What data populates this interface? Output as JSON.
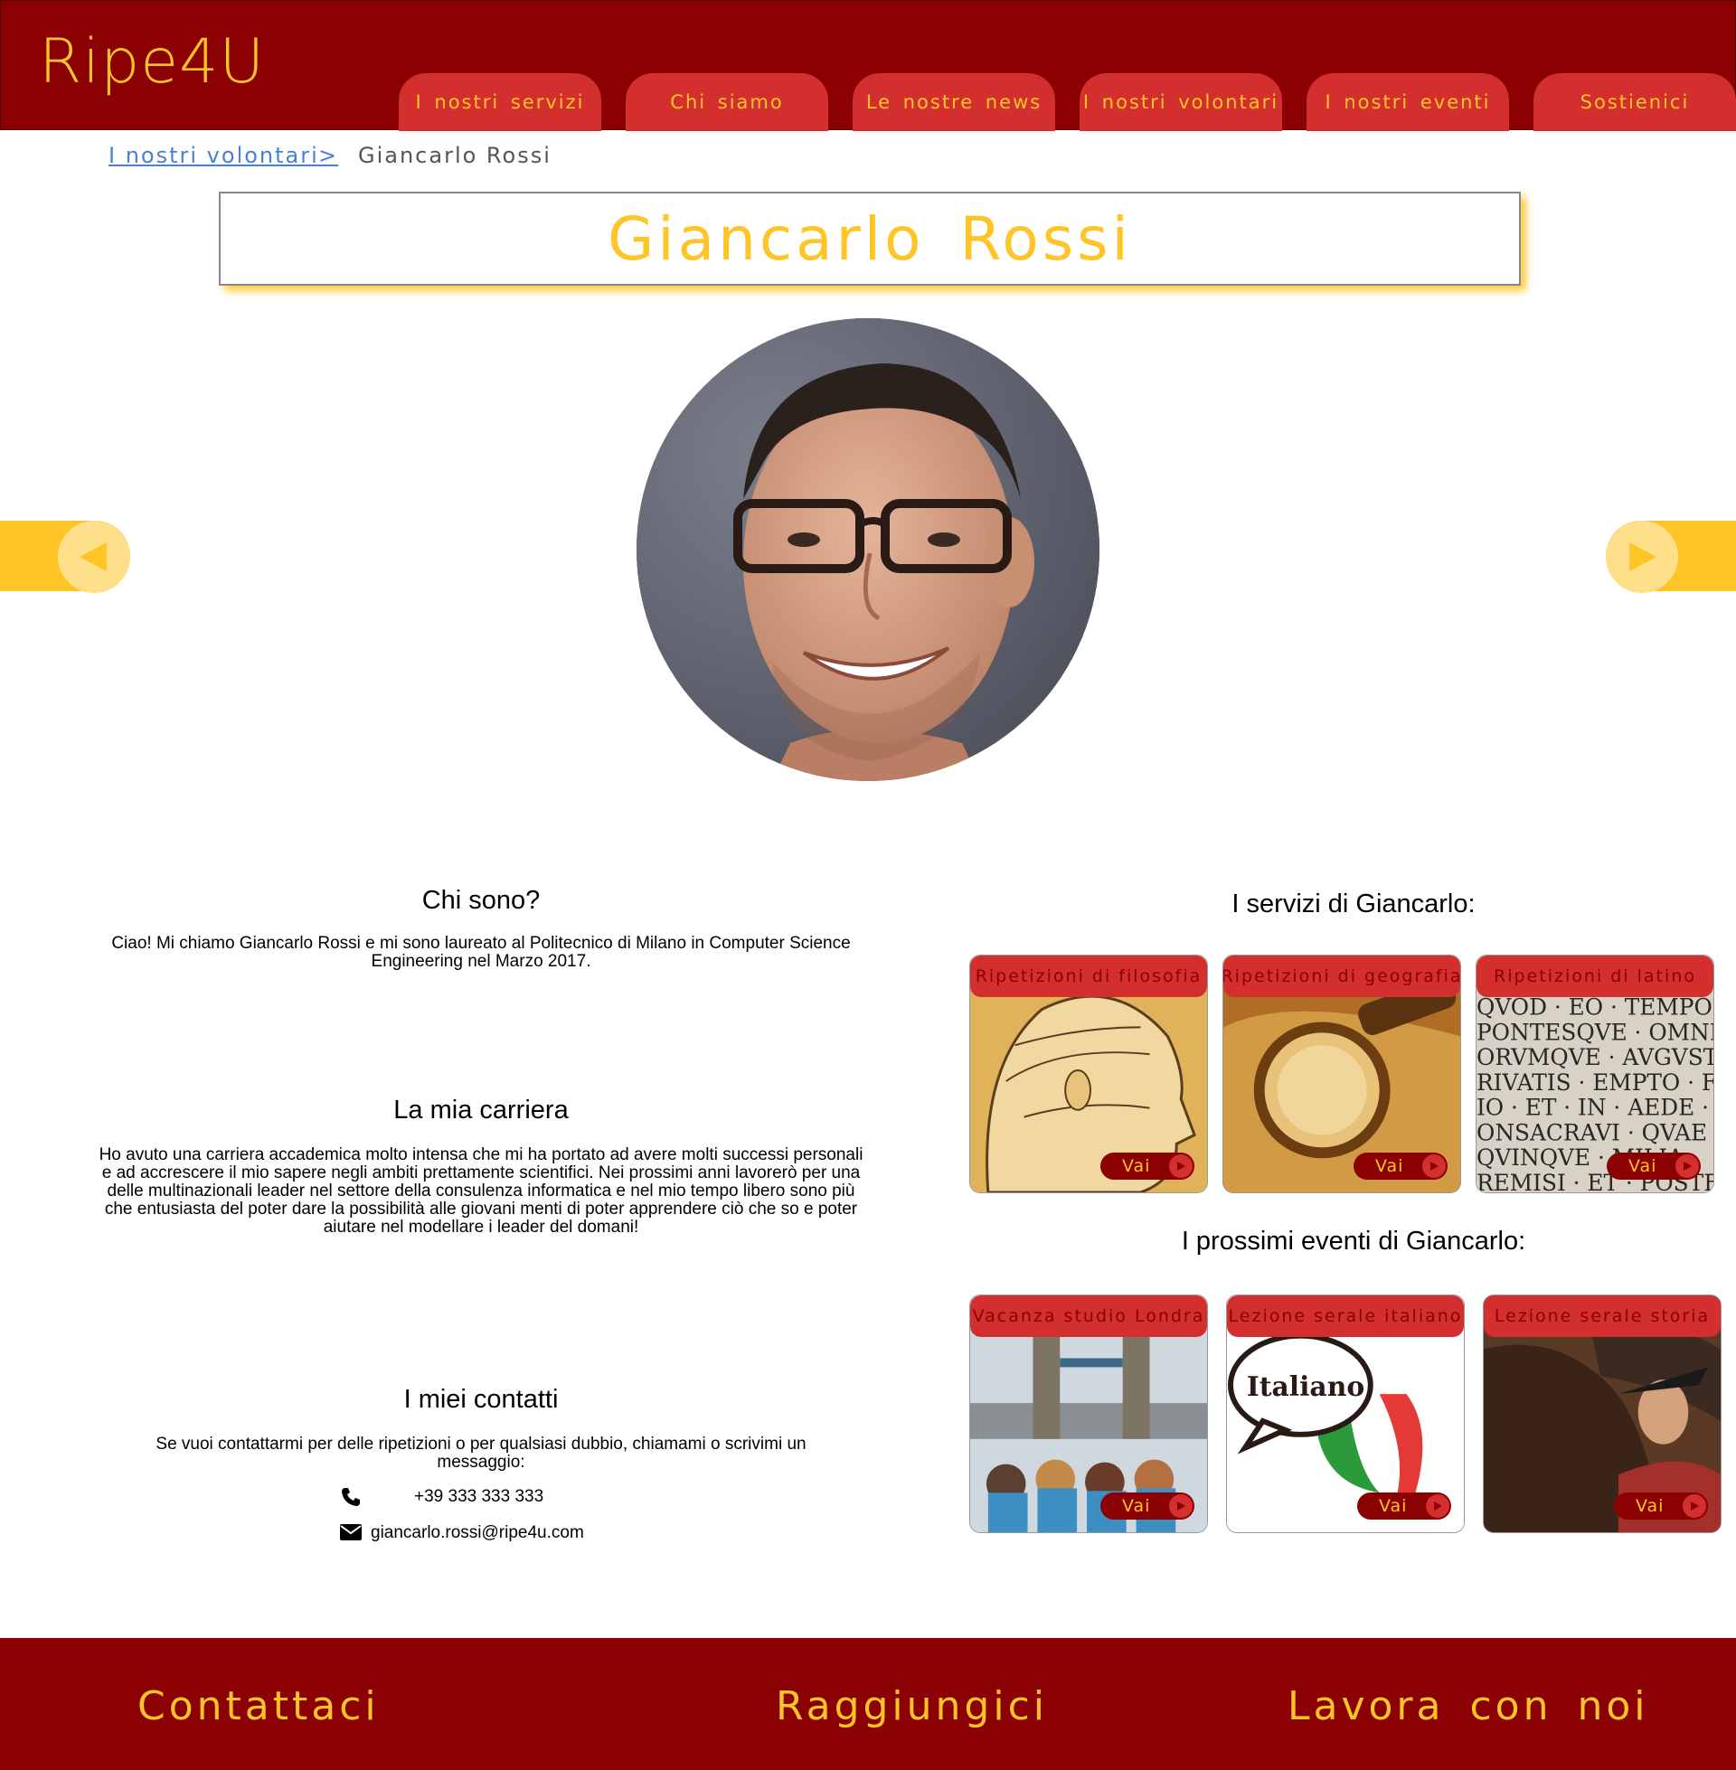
{
  "header": {
    "logo": "Ripe4U",
    "nav": [
      {
        "label": "I nostri servizi"
      },
      {
        "label": "Chi siamo"
      },
      {
        "label": "Le nostre news"
      },
      {
        "label": "I nostri volontari"
      },
      {
        "label": "I nostri eventi"
      },
      {
        "label": "Sostienici"
      }
    ]
  },
  "breadcrumb": {
    "parent": "I nostri volontari",
    "separator": ">",
    "current": "Giancarlo Rossi"
  },
  "profile": {
    "name": "Giancarlo Rossi"
  },
  "about": {
    "title": "Chi sono?",
    "text": "Ciao! Mi chiamo Giancarlo Rossi e mi sono laureato al Politecnico di Milano in Computer Science Engineering nel Marzo 2017."
  },
  "career": {
    "title": "La mia carriera",
    "text": "Ho avuto una carriera accademica molto intensa che mi ha portato ad avere molti successi personali e ad accrescere il mio sapere negli ambiti prettamente scientifici. Nei prossimi anni lavorerò per una delle multinazionali leader nel settore della consulenza informatica e nel mio tempo libero sono più che entusiasta del poter dare la possibilità alle giovani menti di poter apprendere ciò che so e poter aiutare nel modellare i leader del domani!"
  },
  "contacts": {
    "title": "I miei contatti",
    "text": "Se vuoi contattarmi per delle ripetizioni o per qualsiasi dubbio, chiamami o scrivimi un messaggio:",
    "phone": "+39 333 333 333",
    "email": "giancarlo.rossi@ripe4u.com",
    "phone_icon": "phone-icon",
    "email_icon": "envelope-icon"
  },
  "services": {
    "title": "I servizi di Giancarlo:",
    "items": [
      {
        "label": "Ripetizioni di filosofia",
        "button": "Vai"
      },
      {
        "label": "Ripetizioni di geografia",
        "button": "Vai"
      },
      {
        "label": "Ripetizioni di latino",
        "button": "Vai"
      }
    ]
  },
  "events": {
    "title": "I prossimi eventi di Giancarlo:",
    "items": [
      {
        "label": "Vacanza studio Londra",
        "button": "Vai"
      },
      {
        "label": "Lezione serale italiano",
        "button": "Vai",
        "art_text": "Italiano"
      },
      {
        "label": "Lezione serale storia",
        "button": "Vai"
      }
    ]
  },
  "latin_inscription": [
    "QVOD · EO · TEMPOR",
    "PONTESQVE · OMNES",
    "ORVMQVE · AVGVSTV",
    "RIVATIS · EMPTO · FECI",
    "IO · ET · IN · AEDE · DI",
    "ONSACRAVI · QVAE",
    "QVINQVE · MILIA",
    "REMISI · ET · POSTEA"
  ],
  "footer": {
    "links": [
      {
        "label": "Contattaci"
      },
      {
        "label": "Raggiungici"
      },
      {
        "label": "Lavora con noi"
      }
    ]
  },
  "colors": {
    "brand_dark_red": "#8b0000",
    "brand_red": "#d32f2f",
    "brand_yellow": "#ffc425",
    "link_blue": "#4a7fd8"
  }
}
